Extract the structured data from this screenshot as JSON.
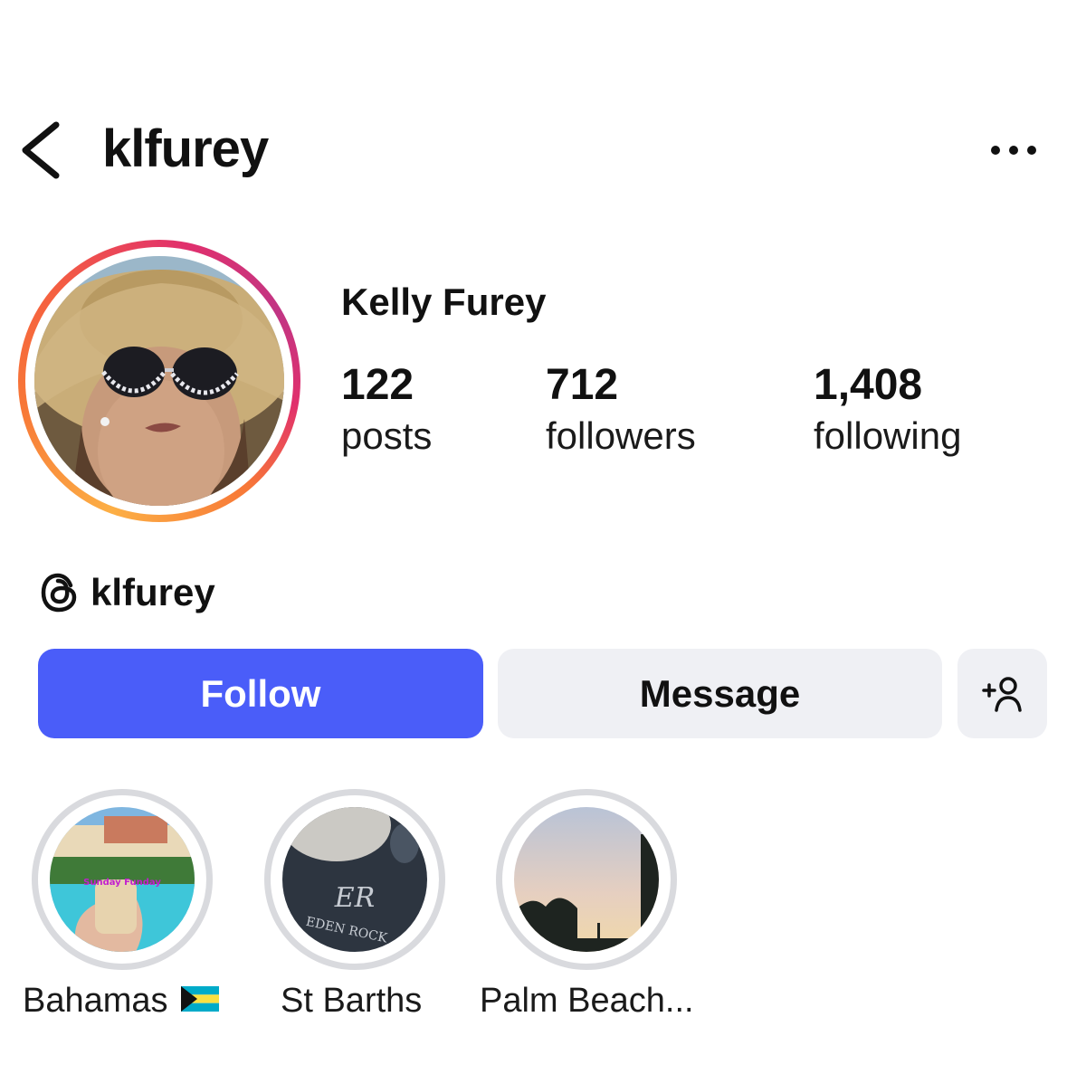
{
  "header": {
    "username": "klfurey",
    "back_icon": "chevron-left-icon",
    "more_icon": "more-horizontal-icon"
  },
  "profile": {
    "full_name": "Kelly Furey",
    "stats": [
      {
        "value": "122",
        "label": "posts"
      },
      {
        "value": "712",
        "label": "followers"
      },
      {
        "value": "1,408",
        "label": "following"
      }
    ],
    "threads": {
      "icon": "threads-icon",
      "handle": "klfurey"
    }
  },
  "actions": {
    "follow_label": "Follow",
    "message_label": "Message",
    "add_user_icon": "add-user-icon"
  },
  "highlights": [
    {
      "label": "Bahamas",
      "flag_icon": "bahamas-flag-icon",
      "cover_text": "Sunday Funday"
    },
    {
      "label": "St Barths",
      "cover_text": "ER",
      "cover_subtext": "EDEN ROCK"
    },
    {
      "label": "Palm Beach..."
    }
  ],
  "colors": {
    "follow_button": "#4a5df9",
    "secondary_button": "#eff0f4",
    "highlight_ring": "#d9dade",
    "story_ring_gradient": [
      "#fcaf45",
      "#f77737",
      "#e1306c",
      "#c13584"
    ]
  }
}
